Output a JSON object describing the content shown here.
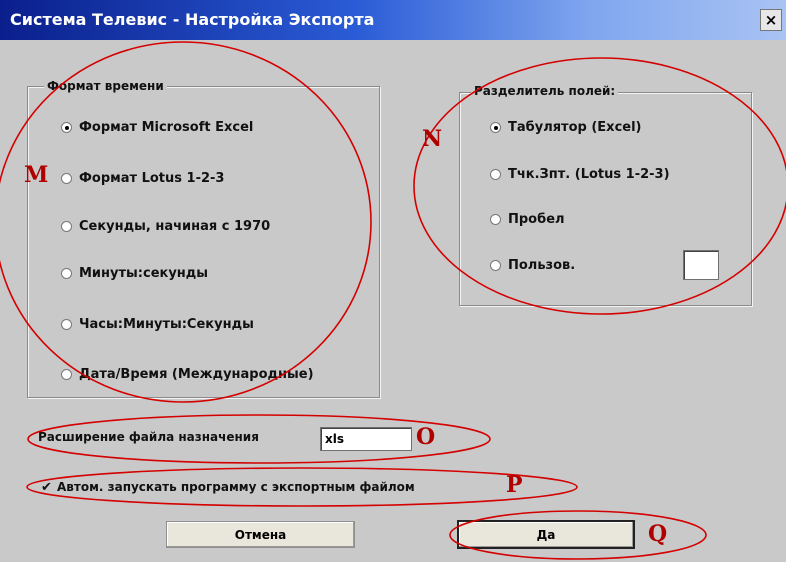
{
  "window": {
    "title": "Система Телевис - Настройка Экспорта",
    "close_glyph": "×"
  },
  "time_format": {
    "title": "Формат времени",
    "options": [
      {
        "label": "Формат Microsoft Excel",
        "selected": true
      },
      {
        "label": "Формат Lotus 1-2-3",
        "selected": false
      },
      {
        "label": "Секунды, начиная с 1970",
        "selected": false
      },
      {
        "label": "Минуты:секунды",
        "selected": false
      },
      {
        "label": "Часы:Минуты:Секунды",
        "selected": false
      },
      {
        "label": "Дата/Время (Международные)",
        "selected": false
      }
    ]
  },
  "separator": {
    "title": "Разделитель полей:",
    "options": [
      {
        "label": "Табулятор (Excel)",
        "selected": true
      },
      {
        "label": "Тчк.Зпт. (Lotus 1-2-3)",
        "selected": false
      },
      {
        "label": "Пробел",
        "selected": false
      },
      {
        "label": "Пользов.",
        "selected": false
      }
    ],
    "custom_value": ""
  },
  "extension": {
    "label": "Расширение файла назначения",
    "value": "xls"
  },
  "autorun": {
    "label": "Автом. запускать программу с экспортным файлом",
    "checked": true,
    "glyph": "✔"
  },
  "buttons": {
    "cancel": "Отмена",
    "ok": "Да"
  },
  "callouts": {
    "M": "M",
    "N": "N",
    "O": "O",
    "P": "P",
    "Q": "Q",
    "color": "#d40000"
  }
}
